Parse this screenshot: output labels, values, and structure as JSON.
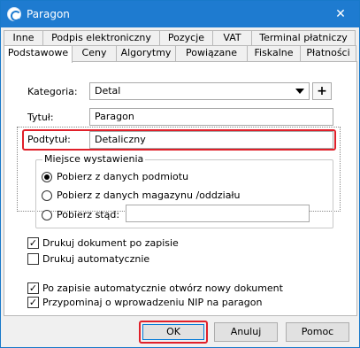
{
  "window": {
    "title": "Paragon",
    "close_glyph": "✕"
  },
  "tabs_top": [
    "Inne",
    "Podpis elektroniczny",
    "Pozycje",
    "VAT",
    "Terminal płatniczy"
  ],
  "tabs_bottom": [
    "Podstawowe",
    "Ceny",
    "Algorytmy",
    "Powiązane",
    "Fiskalne",
    "Płatności"
  ],
  "form": {
    "kategoria_label": "Kategoria:",
    "kategoria_value": "Detal",
    "add_glyph": "+",
    "tytul_label": "Tytuł:",
    "tytul_value": "Paragon",
    "podtytul_label": "Podtytuł:",
    "podtytul_value": "Detaliczny"
  },
  "miejsce": {
    "title": "Miejsce wystawienia",
    "opt1": "Pobierz z danych podmiotu",
    "opt2": "Pobierz z danych magazynu /oddziału",
    "opt3": "Pobierz stąd:",
    "opt3_value": "",
    "selected": "opt1"
  },
  "checks": {
    "drukuj_po_zapisie": "Drukuj dokument po zapisie",
    "drukuj_auto": "Drukuj automatycznie",
    "otworz_nowy": "Po zapisie automatycznie otwórz nowy dokument",
    "przypominaj_nip": "Przypominaj o wprowadzeniu NIP na paragon",
    "check_glyph": "✓"
  },
  "buttons": {
    "ok": "OK",
    "anuluj": "Anuluj",
    "pomoc": "Pomoc"
  },
  "colors": {
    "titlebar": "#1e7bd0",
    "highlight": "#e0202a"
  }
}
